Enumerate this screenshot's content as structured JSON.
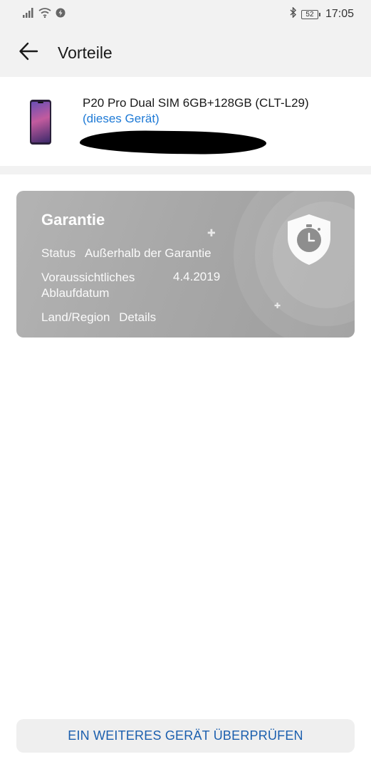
{
  "status_bar": {
    "time": "17:05",
    "battery": "52"
  },
  "header": {
    "title": "Vorteile",
    "back_icon": "arrow-left-icon"
  },
  "device": {
    "name": "P20 Pro Dual SIM 6GB+128GB (CLT-L29)",
    "tag": "(dieses Gerät)"
  },
  "warranty": {
    "title": "Garantie",
    "status_label": "Status",
    "status_value": "Außerhalb der Garantie",
    "expiry_label": "Voraussichtliches Ablaufdatum",
    "expiry_value": "4.4.2019",
    "region_label": "Land/Region",
    "region_value": "Details",
    "icon": "shield-timer-icon"
  },
  "footer": {
    "check_another_label": "EIN WEITERES GERÄT ÜBERPRÜFEN"
  },
  "colors": {
    "link": "#1e7ad6",
    "button_text": "#1b5fae",
    "card_gray": "#a8a8a8"
  }
}
